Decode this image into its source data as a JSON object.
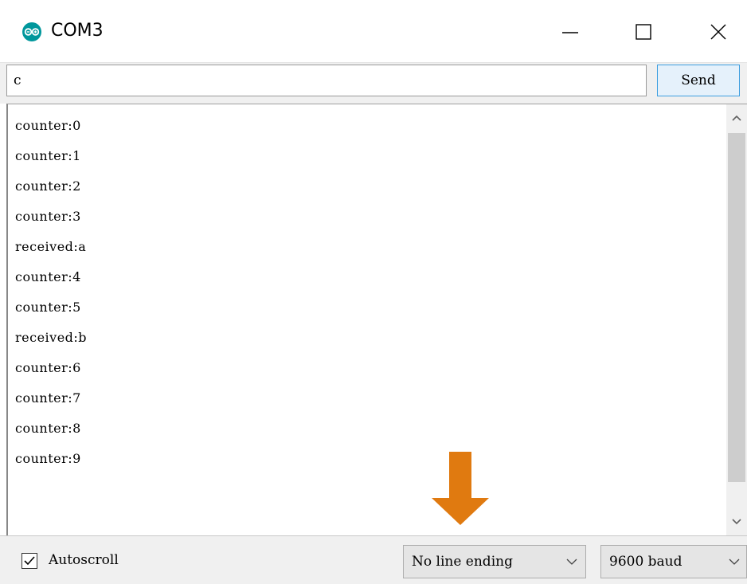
{
  "window": {
    "title": "COM3",
    "icon": "arduino-icon",
    "controls": [
      "minimize-icon",
      "maximize-icon",
      "close-icon"
    ]
  },
  "send": {
    "input_value": "c",
    "button_label": "Send"
  },
  "output": {
    "lines": [
      "counter:0",
      "counter:1",
      "counter:2",
      "counter:3",
      "received:a",
      "counter:4",
      "counter:5",
      "received:b",
      "counter:6",
      "counter:7",
      "counter:8",
      "counter:9"
    ]
  },
  "footer": {
    "autoscroll_label": "Autoscroll",
    "autoscroll_checked": true,
    "line_ending_selected": "No line ending",
    "baud_selected": "9600 baud"
  },
  "annotation": {
    "arrow_color": "#e07a10",
    "points_to": "line-ending-select"
  },
  "colors": {
    "accent": "#00979c",
    "button_border": "#3d9ee0",
    "button_bg": "#e5f1fb"
  }
}
